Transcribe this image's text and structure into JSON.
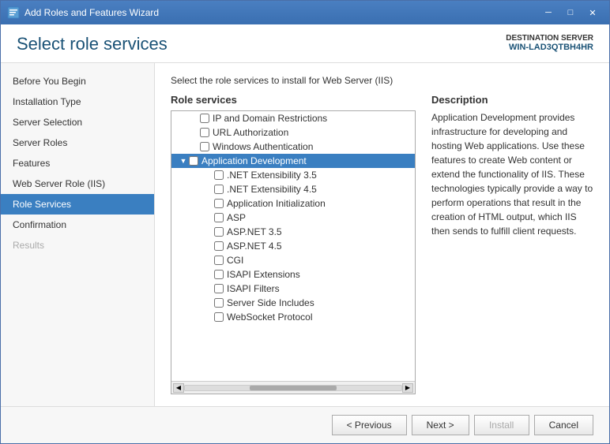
{
  "window": {
    "title": "Add Roles and Features Wizard",
    "min_label": "─",
    "max_label": "□",
    "close_label": "✕"
  },
  "header": {
    "title": "Select role services",
    "server_label": "DESTINATION SERVER",
    "server_name": "WIN-LAD3QTBH4HR"
  },
  "sidebar": {
    "items": [
      {
        "label": "Before You Begin",
        "state": "normal"
      },
      {
        "label": "Installation Type",
        "state": "normal"
      },
      {
        "label": "Server Selection",
        "state": "normal"
      },
      {
        "label": "Server Roles",
        "state": "normal"
      },
      {
        "label": "Features",
        "state": "normal"
      },
      {
        "label": "Web Server Role (IIS)",
        "state": "normal"
      },
      {
        "label": "Role Services",
        "state": "active"
      },
      {
        "label": "Confirmation",
        "state": "normal"
      },
      {
        "label": "Results",
        "state": "dimmed"
      }
    ]
  },
  "content": {
    "intro": "Select the role services to install for Web Server (IIS)",
    "role_services_label": "Role services",
    "description_label": "Description",
    "description_text": "Application Development provides infrastructure for developing and hosting Web applications. Use these features to create Web content or extend the functionality of IIS. These technologies typically provide a way to perform operations that result in the creation of HTML output, which IIS then sends to fulfill client requests.",
    "list_items": [
      {
        "label": "IP and Domain Restrictions",
        "indent": 2,
        "checked": false,
        "expanded": false,
        "selected": false
      },
      {
        "label": "URL Authorization",
        "indent": 2,
        "checked": false,
        "expanded": false,
        "selected": false
      },
      {
        "label": "Windows Authentication",
        "indent": 2,
        "checked": false,
        "expanded": false,
        "selected": false
      },
      {
        "label": "Application Development",
        "indent": 1,
        "checked": false,
        "expanded": true,
        "selected": true,
        "hasExpand": true
      },
      {
        "label": ".NET Extensibility 3.5",
        "indent": 2,
        "checked": false,
        "expanded": false,
        "selected": false
      },
      {
        "label": ".NET Extensibility 4.5",
        "indent": 2,
        "checked": false,
        "expanded": false,
        "selected": false
      },
      {
        "label": "Application Initialization",
        "indent": 2,
        "checked": false,
        "expanded": false,
        "selected": false
      },
      {
        "label": "ASP",
        "indent": 2,
        "checked": false,
        "expanded": false,
        "selected": false
      },
      {
        "label": "ASP.NET 3.5",
        "indent": 2,
        "checked": false,
        "expanded": false,
        "selected": false
      },
      {
        "label": "ASP.NET 4.5",
        "indent": 2,
        "checked": false,
        "expanded": false,
        "selected": false
      },
      {
        "label": "CGI",
        "indent": 2,
        "checked": false,
        "expanded": false,
        "selected": false
      },
      {
        "label": "ISAPI Extensions",
        "indent": 2,
        "checked": false,
        "expanded": false,
        "selected": false
      },
      {
        "label": "ISAPI Filters",
        "indent": 2,
        "checked": false,
        "expanded": false,
        "selected": false
      },
      {
        "label": "Server Side Includes",
        "indent": 2,
        "checked": false,
        "expanded": false,
        "selected": false
      },
      {
        "label": "WebSocket Protocol",
        "indent": 2,
        "checked": false,
        "expanded": false,
        "selected": false
      }
    ]
  },
  "footer": {
    "previous_label": "< Previous",
    "next_label": "Next >",
    "install_label": "Install",
    "cancel_label": "Cancel"
  }
}
